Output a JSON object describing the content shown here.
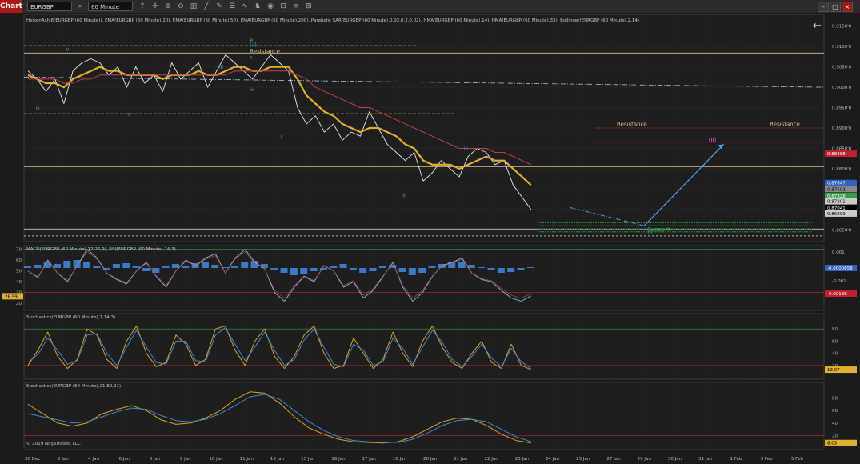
{
  "toolbar": {
    "tab_label": "Chart",
    "instrument": "EURGBP",
    "interval": "60 Minute",
    "icons": [
      "search-icon",
      "cursor-icon",
      "zoom-in-icon",
      "zoom-out-icon",
      "bars-icon",
      "trendline-icon",
      "draw-icon",
      "properties-icon",
      "indicator-icon",
      "strategy-icon",
      "screenshot-icon",
      "lock-icon",
      "list-icon",
      "grid-icon"
    ]
  },
  "window": {
    "min_label": "–",
    "max_label": "□",
    "close_label": "×"
  },
  "colors": {
    "background": "#1b1b1b",
    "price_up": "#4caf50",
    "ema_fast": "#e0b030",
    "ema_slow": "#c04050",
    "resistance": "#e8c08a",
    "support": "#30a040",
    "projection": "#5a9ee0"
  },
  "chart_data": [
    {
      "type": "line",
      "title": "HeikenAshi8(EURGBP (60 Minute)), EMA(EURGBP (60 Minute),20), EMA(EURGBP (60 Minute),50), EMA(EURGBP (60 Minute),200), Parabolic SAR(EURGBP (60 Minute),0.02,0.2,0.02), HMA(EURGBP (60 Minute),14), HMA(EURGBP (60 Minute),33), Bollinger(EURGBP (60 Minute),2,14)",
      "x_categories": [
        "30 Dec",
        "2 Jan",
        "4 Jan",
        "6 Jan",
        "8 Jan",
        "9 Jan",
        "10 Jan",
        "11 Jan",
        "13 Jan",
        "15 Jan",
        "16 Jan",
        "17 Jan",
        "18 Jan",
        "20 Jan",
        "21 Jan",
        "22 Jan",
        "23 Jan",
        "24 Jan",
        "25 Jan",
        "27 Jan",
        "29 Jan",
        "30 Jan",
        "31 Jan",
        "1 Feb",
        "3 Feb",
        "5 Feb"
      ],
      "ylim": [
        0.8625,
        0.9175
      ],
      "y_ticks": [
        "0.8650'0",
        "0.8700'0",
        "0.8750'0",
        "0.8800'0",
        "0.8850'0",
        "0.8900'0",
        "0.8950'0",
        "0.9000'0",
        "0.9050'0",
        "0.9100'0",
        "0.9150'0"
      ],
      "series": [
        {
          "values": [
            0.904,
            0.902,
            0.899,
            0.902,
            0.896,
            0.904,
            0.906,
            0.907,
            0.906,
            0.903,
            0.905,
            0.9,
            0.905,
            0.901,
            0.903,
            0.899,
            0.906,
            0.902,
            0.904,
            0.906,
            0.9,
            0.904,
            0.908,
            0.906,
            0.904,
            0.902,
            0.905,
            0.908,
            0.906,
            0.904,
            0.895,
            0.891,
            0.893,
            0.889,
            0.891,
            0.887,
            0.889,
            0.888,
            0.894,
            0.89,
            0.886,
            0.884,
            0.882,
            0.884,
            0.877,
            0.879,
            0.882,
            0.88,
            0.878,
            0.883,
            0.885,
            0.884,
            0.881,
            0.882,
            0.876,
            0.873,
            0.87
          ]
        },
        {
          "values": [
            0.903,
            0.902,
            0.901,
            0.901,
            0.9,
            0.902,
            0.903,
            0.904,
            0.905,
            0.904,
            0.904,
            0.903,
            0.903,
            0.903,
            0.903,
            0.902,
            0.903,
            0.903,
            0.903,
            0.904,
            0.903,
            0.903,
            0.904,
            0.905,
            0.905,
            0.904,
            0.904,
            0.905,
            0.905,
            0.905,
            0.902,
            0.898,
            0.896,
            0.894,
            0.893,
            0.891,
            0.89,
            0.889,
            0.89,
            0.89,
            0.889,
            0.888,
            0.886,
            0.885,
            0.882,
            0.881,
            0.881,
            0.881,
            0.88,
            0.881,
            0.882,
            0.883,
            0.882,
            0.882,
            0.88,
            0.878,
            0.876
          ]
        },
        {
          "values": [
            0.902,
            0.902,
            0.902,
            0.902,
            0.901,
            0.901,
            0.902,
            0.902,
            0.903,
            0.903,
            0.903,
            0.903,
            0.903,
            0.903,
            0.903,
            0.903,
            0.903,
            0.903,
            0.903,
            0.903,
            0.903,
            0.903,
            0.903,
            0.904,
            0.904,
            0.904,
            0.904,
            0.904,
            0.904,
            0.904,
            0.903,
            0.902,
            0.9,
            0.899,
            0.898,
            0.897,
            0.896,
            0.895,
            0.895,
            0.894,
            0.893,
            0.892,
            0.891,
            0.89,
            0.889,
            0.888,
            0.887,
            0.886,
            0.885,
            0.885,
            0.885,
            0.885,
            0.884,
            0.884,
            0.883,
            0.882,
            0.881
          ]
        }
      ],
      "annotations": [
        {
          "label": "Resistance",
          "x": "11 Jan",
          "y": 0.9084
        },
        {
          "label": "Resistance",
          "x": "27 Jan",
          "y": 0.8905
        },
        {
          "label": "Resistance",
          "x": "3 Feb",
          "y": 0.8905
        },
        {
          "label": "Support",
          "x": "29 Jan",
          "y": 0.8647
        },
        {
          "label": "(II)",
          "x": "31 Jan",
          "y": 0.8867
        },
        {
          "label": "B",
          "x": "11 Jan",
          "y": 0.911
        },
        {
          "label": "[a]",
          "x": "11 Jan",
          "y": 0.91
        },
        {
          "label": "(I)",
          "x": "11 Jan",
          "y": 0.9085
        },
        {
          "label": "c",
          "x": "11 Jan",
          "y": 0.907
        },
        {
          "label": "iv",
          "x": "11 Jan",
          "y": 0.899
        },
        {
          "label": "i",
          "x": "13 Jan",
          "y": 0.8875
        },
        {
          "label": "iii",
          "x": "18 Jan",
          "y": 0.873
        },
        {
          "label": "iv",
          "x": "21 Jan",
          "y": 0.8845
        },
        {
          "label": "v",
          "x": "2 Jan",
          "y": 0.909
        },
        {
          "label": "d",
          "x": "6 Jan",
          "y": 0.893
        },
        {
          "label": "iii",
          "x": "30 Dec",
          "y": 0.8945
        },
        {
          "label": "iii",
          "x": "10 Jan",
          "y": 0.9045
        },
        {
          "label": "(I)",
          "x": "29 Jan",
          "y": 0.864
        }
      ],
      "price_labels": [
        {
          "text": "0.88368",
          "color": "#c02030",
          "value": 0.8837
        },
        {
          "text": "0.87647",
          "color": "#3060c0",
          "value": 0.8765
        },
        {
          "text": "0.87502",
          "color": "#888888",
          "value": 0.875
        },
        {
          "text": "0.87328",
          "color": "#30a040",
          "value": 0.8733
        },
        {
          "text": "0.87201",
          "color": "#cccccc",
          "value": 0.872
        },
        {
          "text": "0.87041",
          "color": "#000000",
          "value": 0.8704
        },
        {
          "text": "0.86899",
          "color": "#cccccc",
          "value": 0.869
        }
      ]
    },
    {
      "type": "bar",
      "title": "MACD(EURGBP (60 Minute),12,26,9), RSI(EURGBP (60 Minute),14,3)",
      "y_ticks_left": [
        "70",
        "60",
        "50",
        "40",
        "30",
        "20"
      ],
      "y_ticks_right": [
        "0.001",
        "-0.001"
      ],
      "rsi_label": "26.59",
      "labels": [
        {
          "text": "-0.0000658",
          "color": "#3060c0"
        },
        {
          "text": "-0.00188",
          "color": "#c02030"
        }
      ],
      "histogram": [
        0.2,
        0.4,
        0.7,
        0.5,
        0.9,
        1.0,
        0.8,
        0.3,
        -0.2,
        0.5,
        0.6,
        0.2,
        -0.4,
        -0.6,
        0.3,
        0.5,
        0.2,
        0.6,
        0.8,
        0.4,
        0.1,
        0.3,
        0.7,
        0.9,
        0.5,
        -0.2,
        -0.6,
        -0.9,
        -0.7,
        -0.4,
        -0.2,
        0.3,
        0.5,
        -0.3,
        -0.6,
        -0.4,
        0.2,
        0.4,
        -0.5,
        -0.9,
        -0.6,
        0.2,
        0.5,
        0.7,
        0.8,
        0.4,
        0.1,
        -0.3,
        -0.6,
        -0.5,
        -0.2,
        0.1
      ],
      "rsi": [
        50,
        44,
        60,
        48,
        40,
        55,
        70,
        62,
        48,
        42,
        38,
        50,
        58,
        45,
        35,
        50,
        60,
        55,
        62,
        66,
        48,
        62,
        70,
        58,
        52,
        30,
        22,
        35,
        45,
        40,
        55,
        50,
        35,
        40,
        25,
        32,
        45,
        58,
        35,
        22,
        30,
        45,
        55,
        58,
        62,
        48,
        42,
        40,
        32,
        25,
        22,
        27
      ]
    },
    {
      "type": "line",
      "title": "Stochastics(EURGBP (60 Minute),7,14,3)",
      "y_ticks": [
        "80",
        "60",
        "40",
        "20"
      ],
      "value_label": "13.07",
      "series": [
        {
          "values": [
            20,
            45,
            75,
            35,
            15,
            30,
            80,
            70,
            30,
            15,
            60,
            85,
            40,
            18,
            25,
            70,
            55,
            20,
            30,
            80,
            85,
            45,
            20,
            60,
            80,
            35,
            15,
            35,
            70,
            85,
            40,
            15,
            20,
            65,
            40,
            15,
            30,
            75,
            40,
            18,
            60,
            85,
            50,
            25,
            15,
            40,
            60,
            25,
            15,
            55,
            20,
            13
          ]
        },
        {
          "values": [
            25,
            38,
            65,
            45,
            22,
            28,
            70,
            72,
            40,
            20,
            50,
            78,
            50,
            25,
            22,
            60,
            60,
            28,
            26,
            70,
            82,
            55,
            28,
            50,
            75,
            45,
            20,
            30,
            62,
            80,
            50,
            22,
            18,
            55,
            45,
            20,
            26,
            65,
            48,
            22,
            50,
            78,
            58,
            30,
            18,
            35,
            55,
            32,
            18,
            48,
            26,
            15
          ]
        }
      ]
    },
    {
      "type": "line",
      "title": "Stochastics(EURGBP (60 Minute),21,89,21)",
      "y_ticks": [
        "80",
        "60",
        "40",
        "20"
      ],
      "value_label": "8.03",
      "footer": "© 2019 NinjaTrader, LLC",
      "series": [
        {
          "values": [
            70,
            55,
            40,
            35,
            40,
            55,
            62,
            68,
            60,
            45,
            38,
            40,
            48,
            60,
            78,
            90,
            88,
            72,
            50,
            32,
            22,
            14,
            10,
            9,
            8,
            10,
            18,
            30,
            42,
            48,
            46,
            36,
            22,
            12,
            8
          ]
        },
        {
          "values": [
            55,
            50,
            45,
            40,
            42,
            50,
            58,
            64,
            62,
            52,
            44,
            42,
            46,
            55,
            68,
            82,
            86,
            78,
            60,
            42,
            28,
            18,
            12,
            10,
            9,
            9,
            14,
            24,
            36,
            44,
            46,
            42,
            30,
            18,
            10
          ]
        }
      ]
    }
  ]
}
